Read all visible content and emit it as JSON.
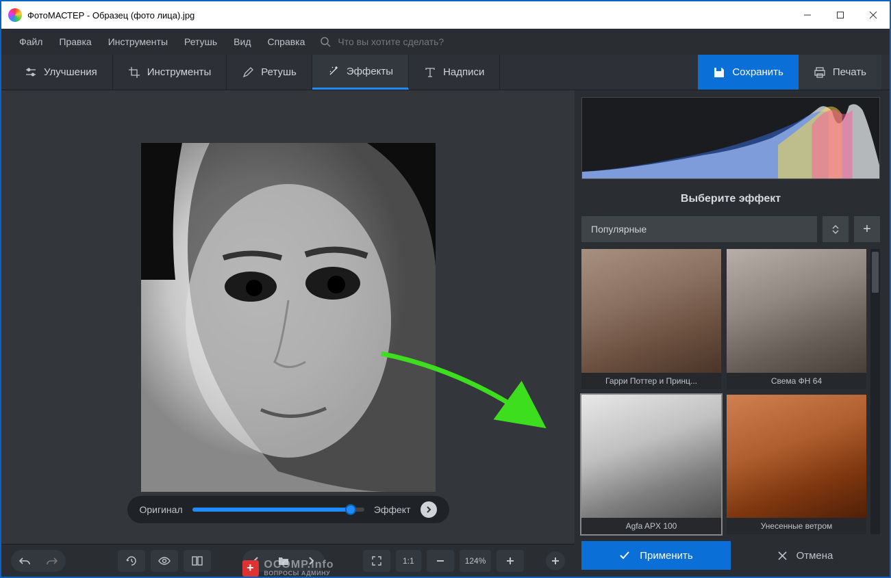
{
  "titlebar": {
    "title": "ФотоМАСТЕР - Образец (фото лица).jpg"
  },
  "menubar": {
    "items": [
      "Файл",
      "Правка",
      "Инструменты",
      "Ретушь",
      "Вид",
      "Справка"
    ],
    "search_placeholder": "Что вы хотите сделать?"
  },
  "toolbar": {
    "tabs": [
      {
        "label": "Улучшения",
        "icon": "sliders-icon"
      },
      {
        "label": "Инструменты",
        "icon": "crop-icon"
      },
      {
        "label": "Ретушь",
        "icon": "brush-icon"
      },
      {
        "label": "Эффекты",
        "icon": "wand-icon",
        "active": true
      },
      {
        "label": "Надписи",
        "icon": "text-icon"
      }
    ],
    "save_label": "Сохранить",
    "print_label": "Печать"
  },
  "canvas": {
    "slider_left": "Оригинал",
    "slider_right": "Эффект"
  },
  "bottombar": {
    "zoom": "1:1",
    "zoom_pct": "124%"
  },
  "panel": {
    "title": "Выберите эффект",
    "category": "Популярные",
    "effects": [
      {
        "label": "Гарри Поттер и Принц..."
      },
      {
        "label": "Свема ФН 64"
      },
      {
        "label": "Agfa APX 100",
        "selected": true
      },
      {
        "label": "Унесенные ветром"
      }
    ],
    "apply_label": "Применить",
    "cancel_label": "Отмена"
  },
  "watermark": {
    "main": "OCOMP.info",
    "sub": "ВОПРОСЫ АДМИНУ"
  }
}
